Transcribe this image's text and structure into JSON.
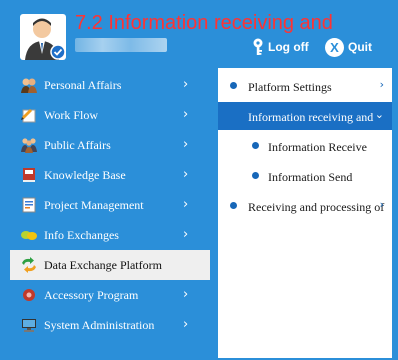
{
  "header": {
    "title": "7.2 Information receiving and",
    "logoff_label": "Log off",
    "quit_label": "Quit"
  },
  "sidebar": {
    "items": [
      {
        "label": "Personal Affairs",
        "icon": "people-icon"
      },
      {
        "label": "Work Flow",
        "icon": "workflow-icon"
      },
      {
        "label": "Public Affairs",
        "icon": "public-affairs-icon"
      },
      {
        "label": "Knowledge Base",
        "icon": "book-icon"
      },
      {
        "label": "Project Management",
        "icon": "project-icon"
      },
      {
        "label": "Info Exchanges",
        "icon": "info-exchange-icon"
      },
      {
        "label": "Data Exchange Platform",
        "icon": "data-exchange-icon"
      },
      {
        "label": "Accessory Program",
        "icon": "accessory-icon"
      },
      {
        "label": "System Administration",
        "icon": "monitor-icon"
      }
    ]
  },
  "submenu": {
    "items": [
      {
        "label": "Platform Settings"
      },
      {
        "label": "Information receiving and"
      },
      {
        "label": "Information Receive"
      },
      {
        "label": "Information Send"
      },
      {
        "label": "Receiving and processing of"
      }
    ]
  },
  "colors": {
    "background": "#2b8fd9",
    "title": "#ff3333",
    "active_submenu": "#1a6fc4",
    "active_nav": "#efefef"
  }
}
